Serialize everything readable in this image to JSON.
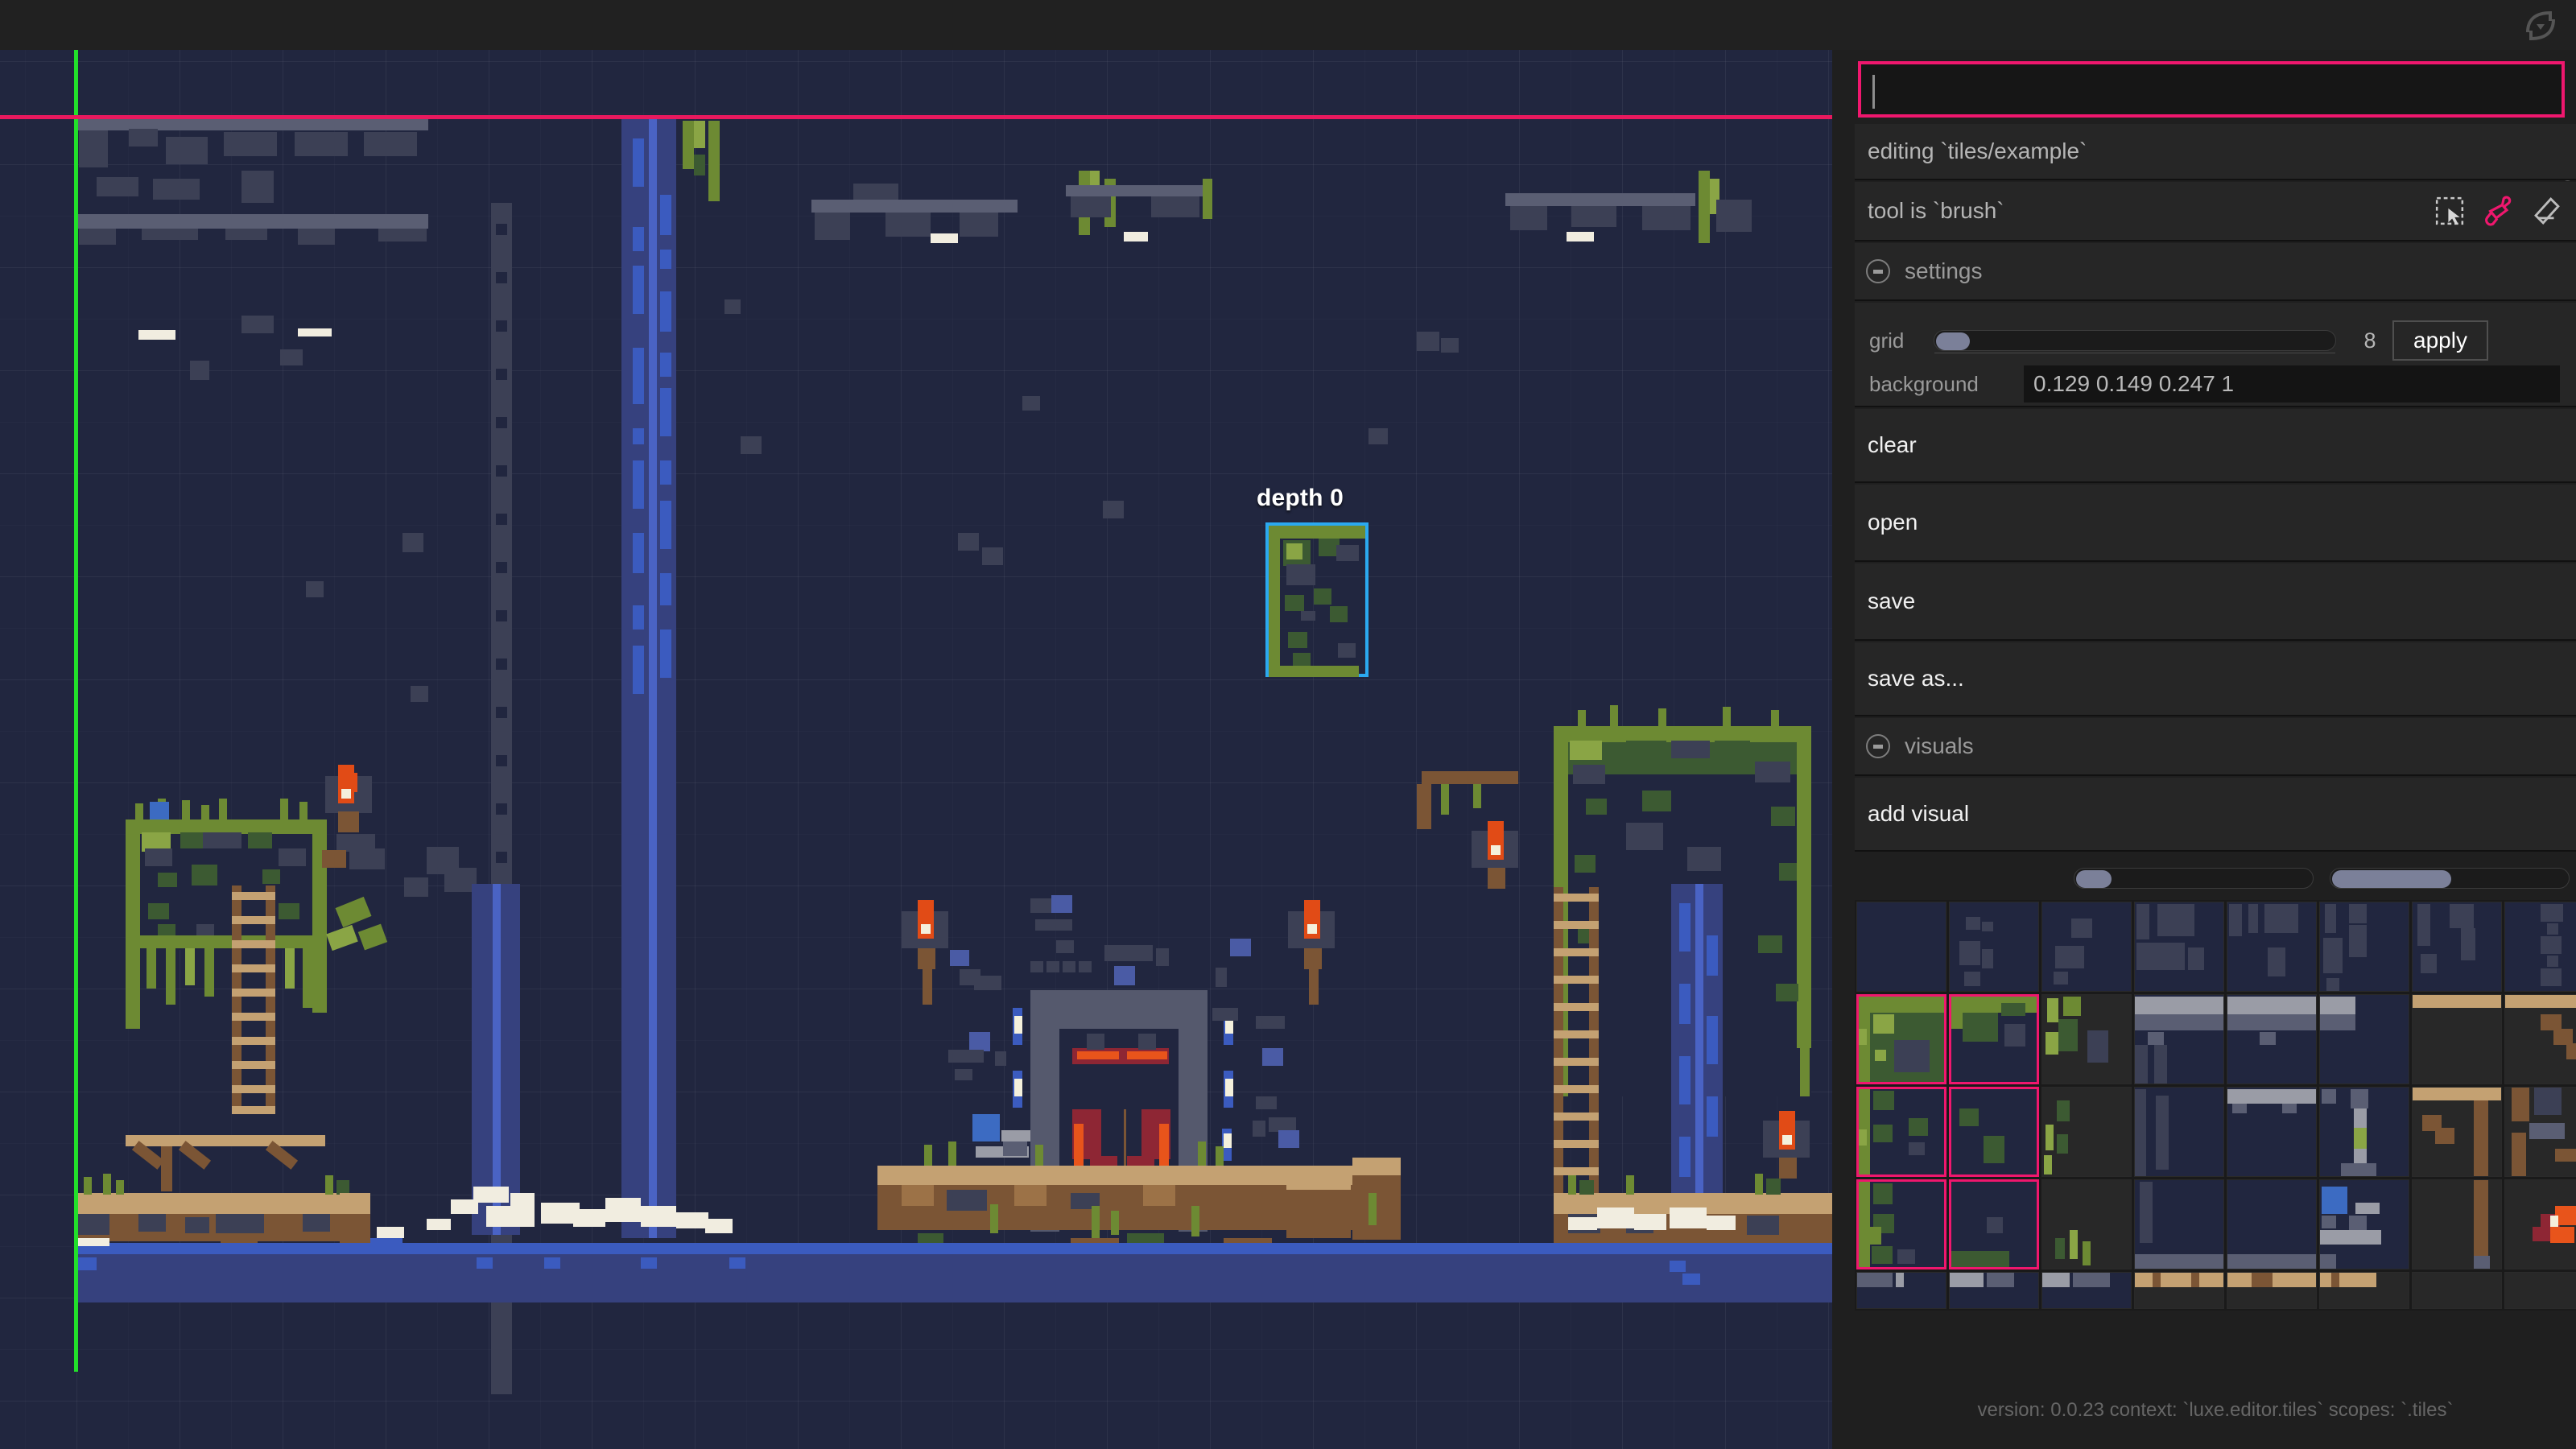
{
  "app": {
    "reload_icon": "reload-icon"
  },
  "command": {
    "value": "",
    "placeholder": ""
  },
  "panel": {
    "editing_label": "editing `tiles/example`",
    "tool_label": "tool is `brush`",
    "tool_icons": [
      {
        "name": "select-icon",
        "active": false
      },
      {
        "name": "brush-icon",
        "active": true
      },
      {
        "name": "eraser-icon",
        "active": false
      }
    ],
    "settings": {
      "header": "settings",
      "grid": {
        "label": "grid",
        "value": "8",
        "apply_label": "apply",
        "fill_percent": 3
      },
      "background": {
        "label": "background",
        "value": "0.129 0.149 0.247 1"
      }
    },
    "actions": [
      {
        "label": "clear",
        "name": "clear"
      },
      {
        "label": "open",
        "name": "open"
      },
      {
        "label": "save",
        "name": "save"
      },
      {
        "label": "save as...",
        "name": "save-as"
      }
    ],
    "visuals": {
      "header": "visuals",
      "add_label": "add visual"
    },
    "palette_sliders": [
      {
        "name": "palette-zoom-slider",
        "fill_percent": 8
      },
      {
        "name": "palette-scroll-slider",
        "fill_percent": 55
      }
    ]
  },
  "canvas": {
    "depth_label": "depth 0",
    "background_color": "#21263f",
    "axis_x_color": "#e8195e",
    "axis_y_color": "#22e02a",
    "brush_outline_color": "#2ba9f0",
    "grid_size": "8"
  },
  "status": {
    "text": "version: 0.0.23 context: `luxe.editor.tiles` scopes: `.tiles`"
  },
  "colors": {
    "accent_pink": "#f0176e",
    "panel_bg": "#1f1f1f",
    "row_bg": "#262626"
  }
}
